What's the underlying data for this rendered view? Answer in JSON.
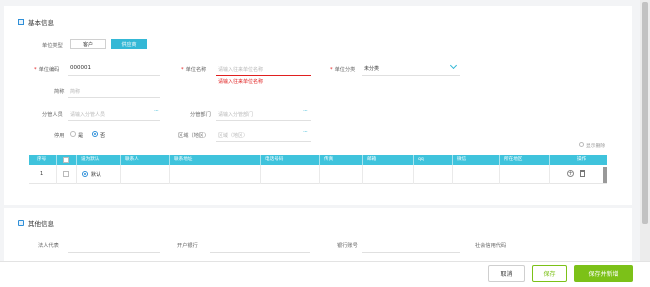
{
  "basic_section": {
    "title": "基本信息"
  },
  "form": {
    "unit_type": {
      "label": "单位类型",
      "options": [
        "客户",
        "供应商"
      ]
    },
    "unit_code": {
      "label": "单位编码",
      "value": "000001"
    },
    "unit_name": {
      "label": "单位名称",
      "placeholder": "请输入往来单位名称",
      "error": "请输入往来单位名称"
    },
    "unit_category": {
      "label": "单位分类",
      "value": "未分类"
    },
    "short_name": {
      "label": "简称",
      "placeholder": "简称"
    },
    "manager": {
      "label": "分管人员",
      "placeholder": "请输入分管人员"
    },
    "department": {
      "label": "分管部门",
      "placeholder": "请输入分管部门"
    },
    "enabled": {
      "label": "停用",
      "yes": "是",
      "no": "否"
    },
    "region": {
      "label": "区域（地区）",
      "placeholder": "区域（地区）"
    }
  },
  "table": {
    "show_deleted": "显示删除",
    "headers": [
      "序号",
      "",
      "设为默认",
      "联系人",
      "联系地址",
      "电话号码",
      "传真",
      "邮箱",
      "qq",
      "微信",
      "所在地区",
      "操作"
    ],
    "rows": [
      {
        "index": "1",
        "default_label": "默认"
      }
    ]
  },
  "other_section": {
    "title": "其他信息",
    "fields": [
      "法人代表",
      "开户银行",
      "银行账号",
      "社会信用代码"
    ]
  },
  "footer": {
    "cancel": "取消",
    "save": "保存",
    "save_new": "保存并新增"
  },
  "colors": {
    "accent": "#34b8d6",
    "header": "#3fc3dc",
    "save_green": "#7cc118",
    "error": "#e02020"
  }
}
